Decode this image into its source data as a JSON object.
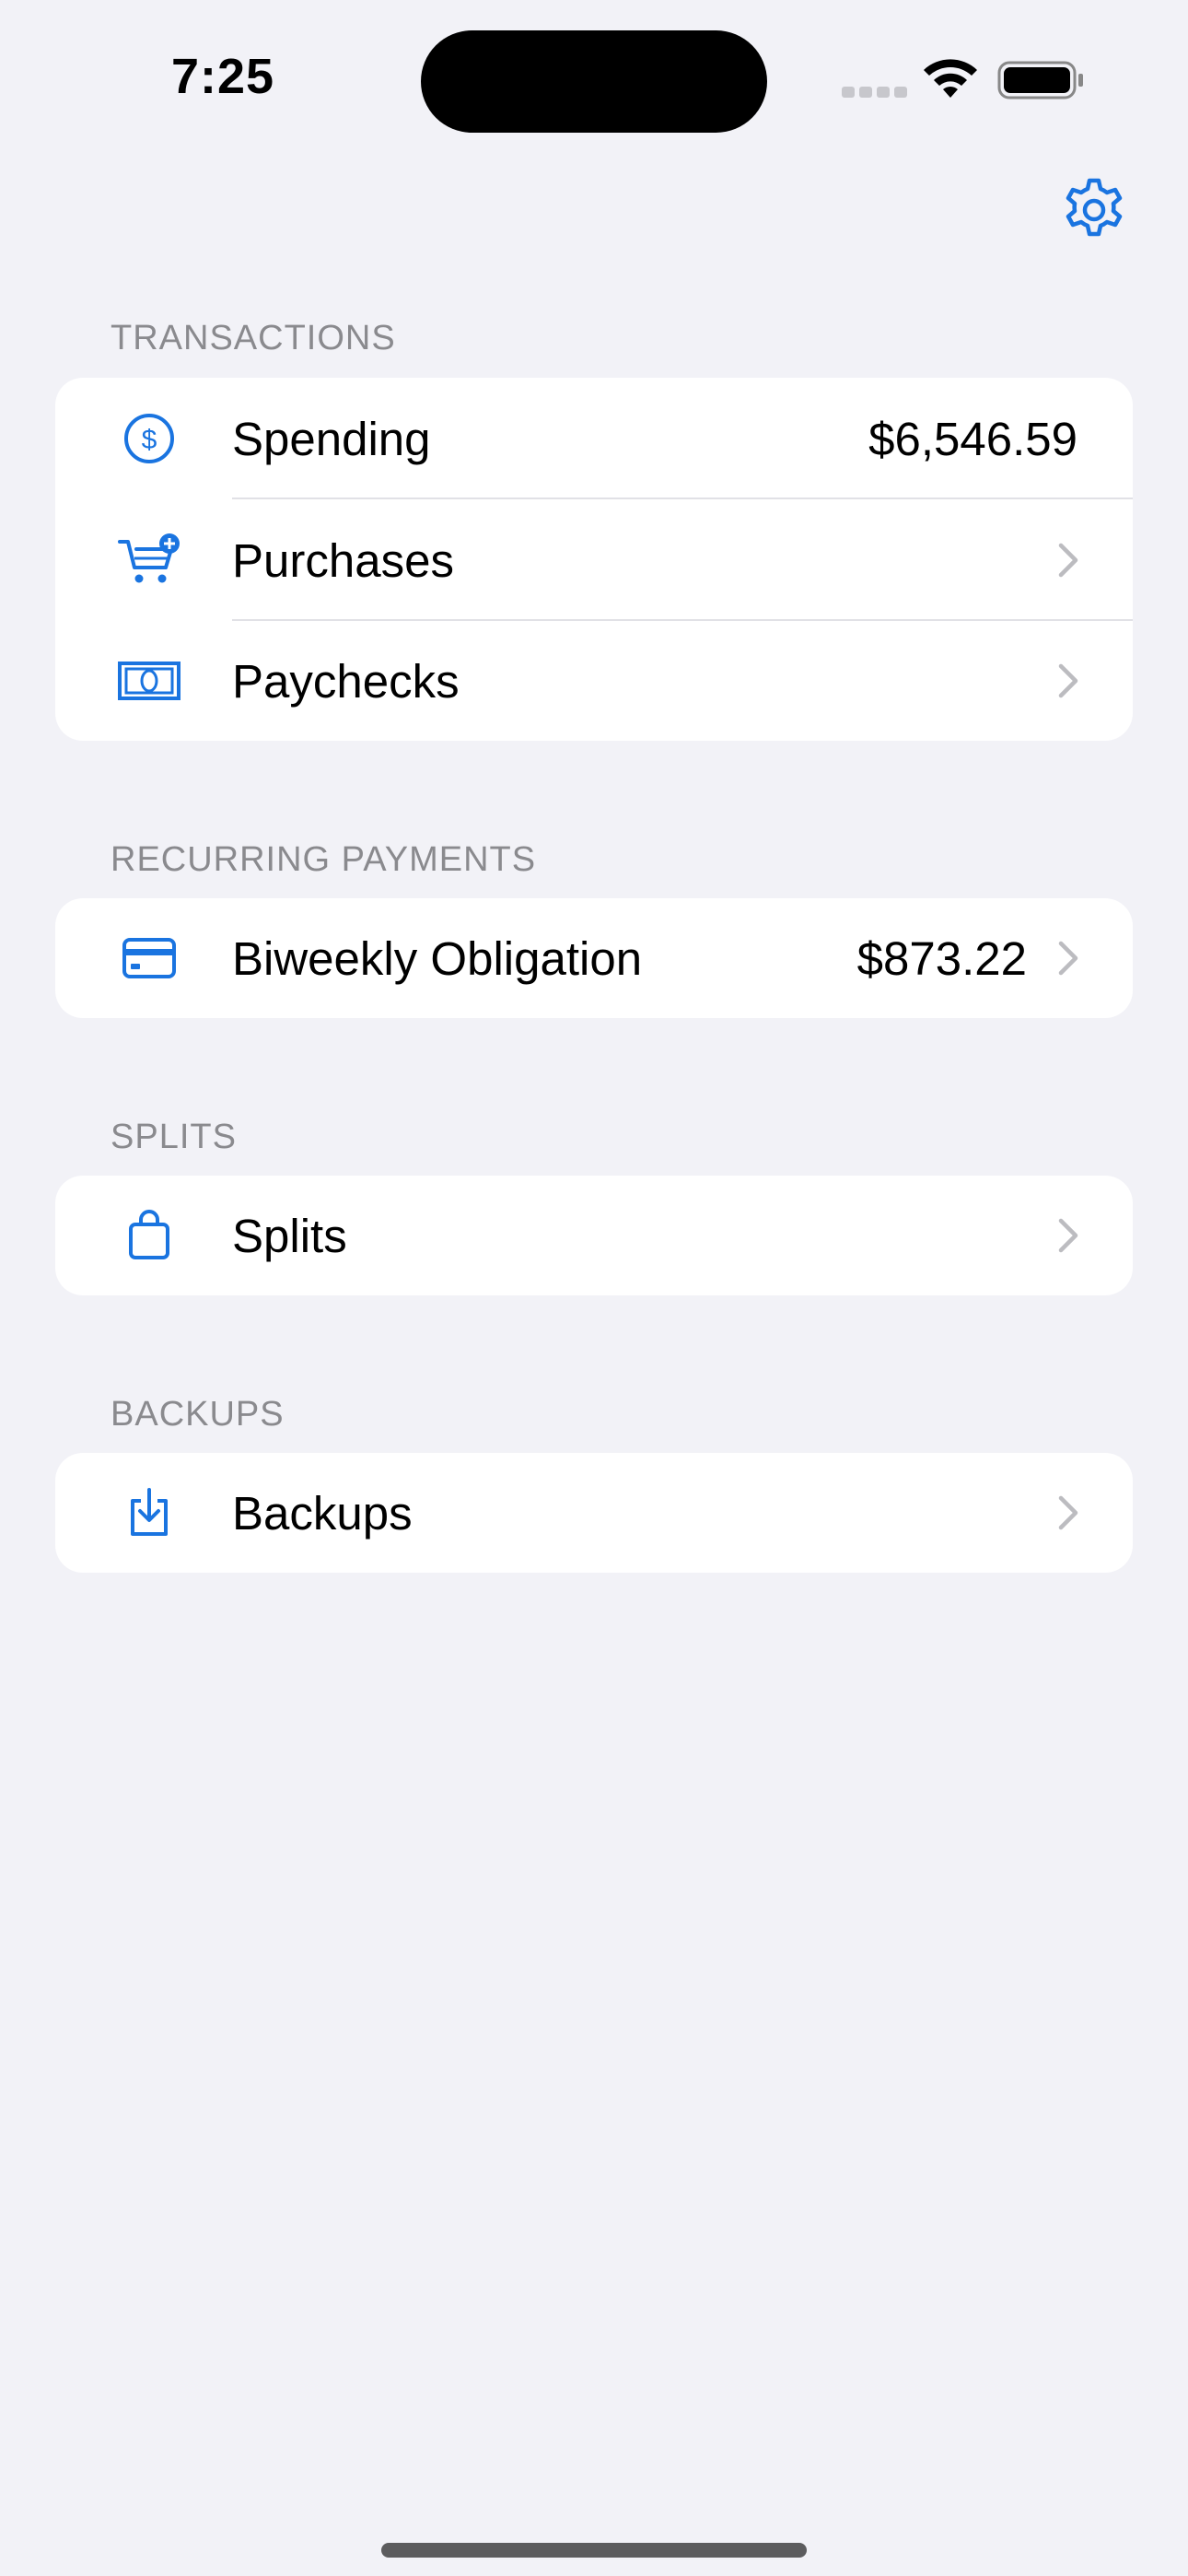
{
  "status_bar": {
    "time": "7:25"
  },
  "accent_color": "#1a74e0",
  "sections": {
    "transactions": {
      "header": "TRANSACTIONS",
      "spending_label": "Spending",
      "spending_value": "$6,546.59",
      "purchases_label": "Purchases",
      "paychecks_label": "Paychecks"
    },
    "recurring": {
      "header": "RECURRING PAYMENTS",
      "biweekly_label": "Biweekly Obligation",
      "biweekly_value": "$873.22"
    },
    "splits": {
      "header": "SPLITS",
      "splits_label": "Splits"
    },
    "backups": {
      "header": "BACKUPS",
      "backups_label": "Backups"
    }
  },
  "icons": {
    "settings": "gear-icon",
    "spending": "dollar-circle-icon",
    "purchases": "cart-plus-icon",
    "paychecks": "banknote-icon",
    "biweekly": "credit-card-icon",
    "splits": "bag-icon",
    "backups": "download-tray-icon",
    "chevron": "chevron-right-icon"
  }
}
